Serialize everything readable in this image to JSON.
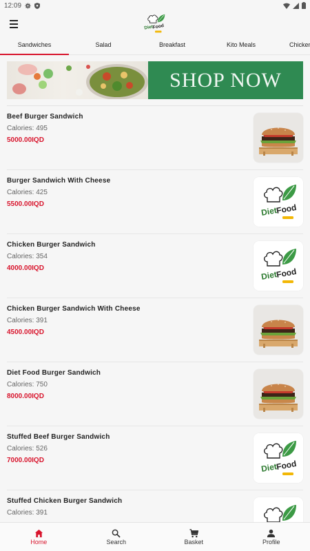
{
  "status_bar": {
    "time": "12:09"
  },
  "tabs": [
    {
      "label": "Sandwiches",
      "active": true
    },
    {
      "label": "Salad",
      "active": false
    },
    {
      "label": "Breakfast",
      "active": false
    },
    {
      "label": "Kito Meals",
      "active": false
    },
    {
      "label": "Chicken",
      "active": false
    }
  ],
  "banner": {
    "cta": "SHOP NOW"
  },
  "products": [
    {
      "name": "Beef Burger Sandwich",
      "calories": "Calories: 495",
      "price": "5000.00IQD",
      "image": "burger-photo"
    },
    {
      "name": "Burger Sandwich With Cheese",
      "calories": "Calories: 425",
      "price": "5500.00IQD",
      "image": "diet-food-logo"
    },
    {
      "name": "Chicken Burger Sandwich",
      "calories": "Calories: 354",
      "price": "4000.00IQD",
      "image": "diet-food-logo"
    },
    {
      "name": "Chicken Burger Sandwich With Cheese",
      "calories": "Calories: 391",
      "price": "4500.00IQD",
      "image": "burger-photo"
    },
    {
      "name": "Diet Food Burger Sandwich",
      "calories": "Calories: 750",
      "price": "8000.00IQD",
      "image": "burger-photo"
    },
    {
      "name": "Stuffed Beef Burger Sandwich",
      "calories": "Calories: 526",
      "price": "7000.00IQD",
      "image": "diet-food-logo"
    },
    {
      "name": "Stuffed Chicken Burger Sandwich",
      "calories": "Calories: 391",
      "price": "",
      "image": "diet-food-logo"
    }
  ],
  "bottom_nav": [
    {
      "label": "Home",
      "icon": "home-icon",
      "active": true
    },
    {
      "label": "Search",
      "icon": "search-icon",
      "active": false
    },
    {
      "label": "Basket",
      "icon": "basket-icon",
      "active": false
    },
    {
      "label": "Profile",
      "icon": "profile-icon",
      "active": false
    }
  ],
  "colors": {
    "accent": "#d8142c",
    "brand_green": "#2f8a52"
  }
}
